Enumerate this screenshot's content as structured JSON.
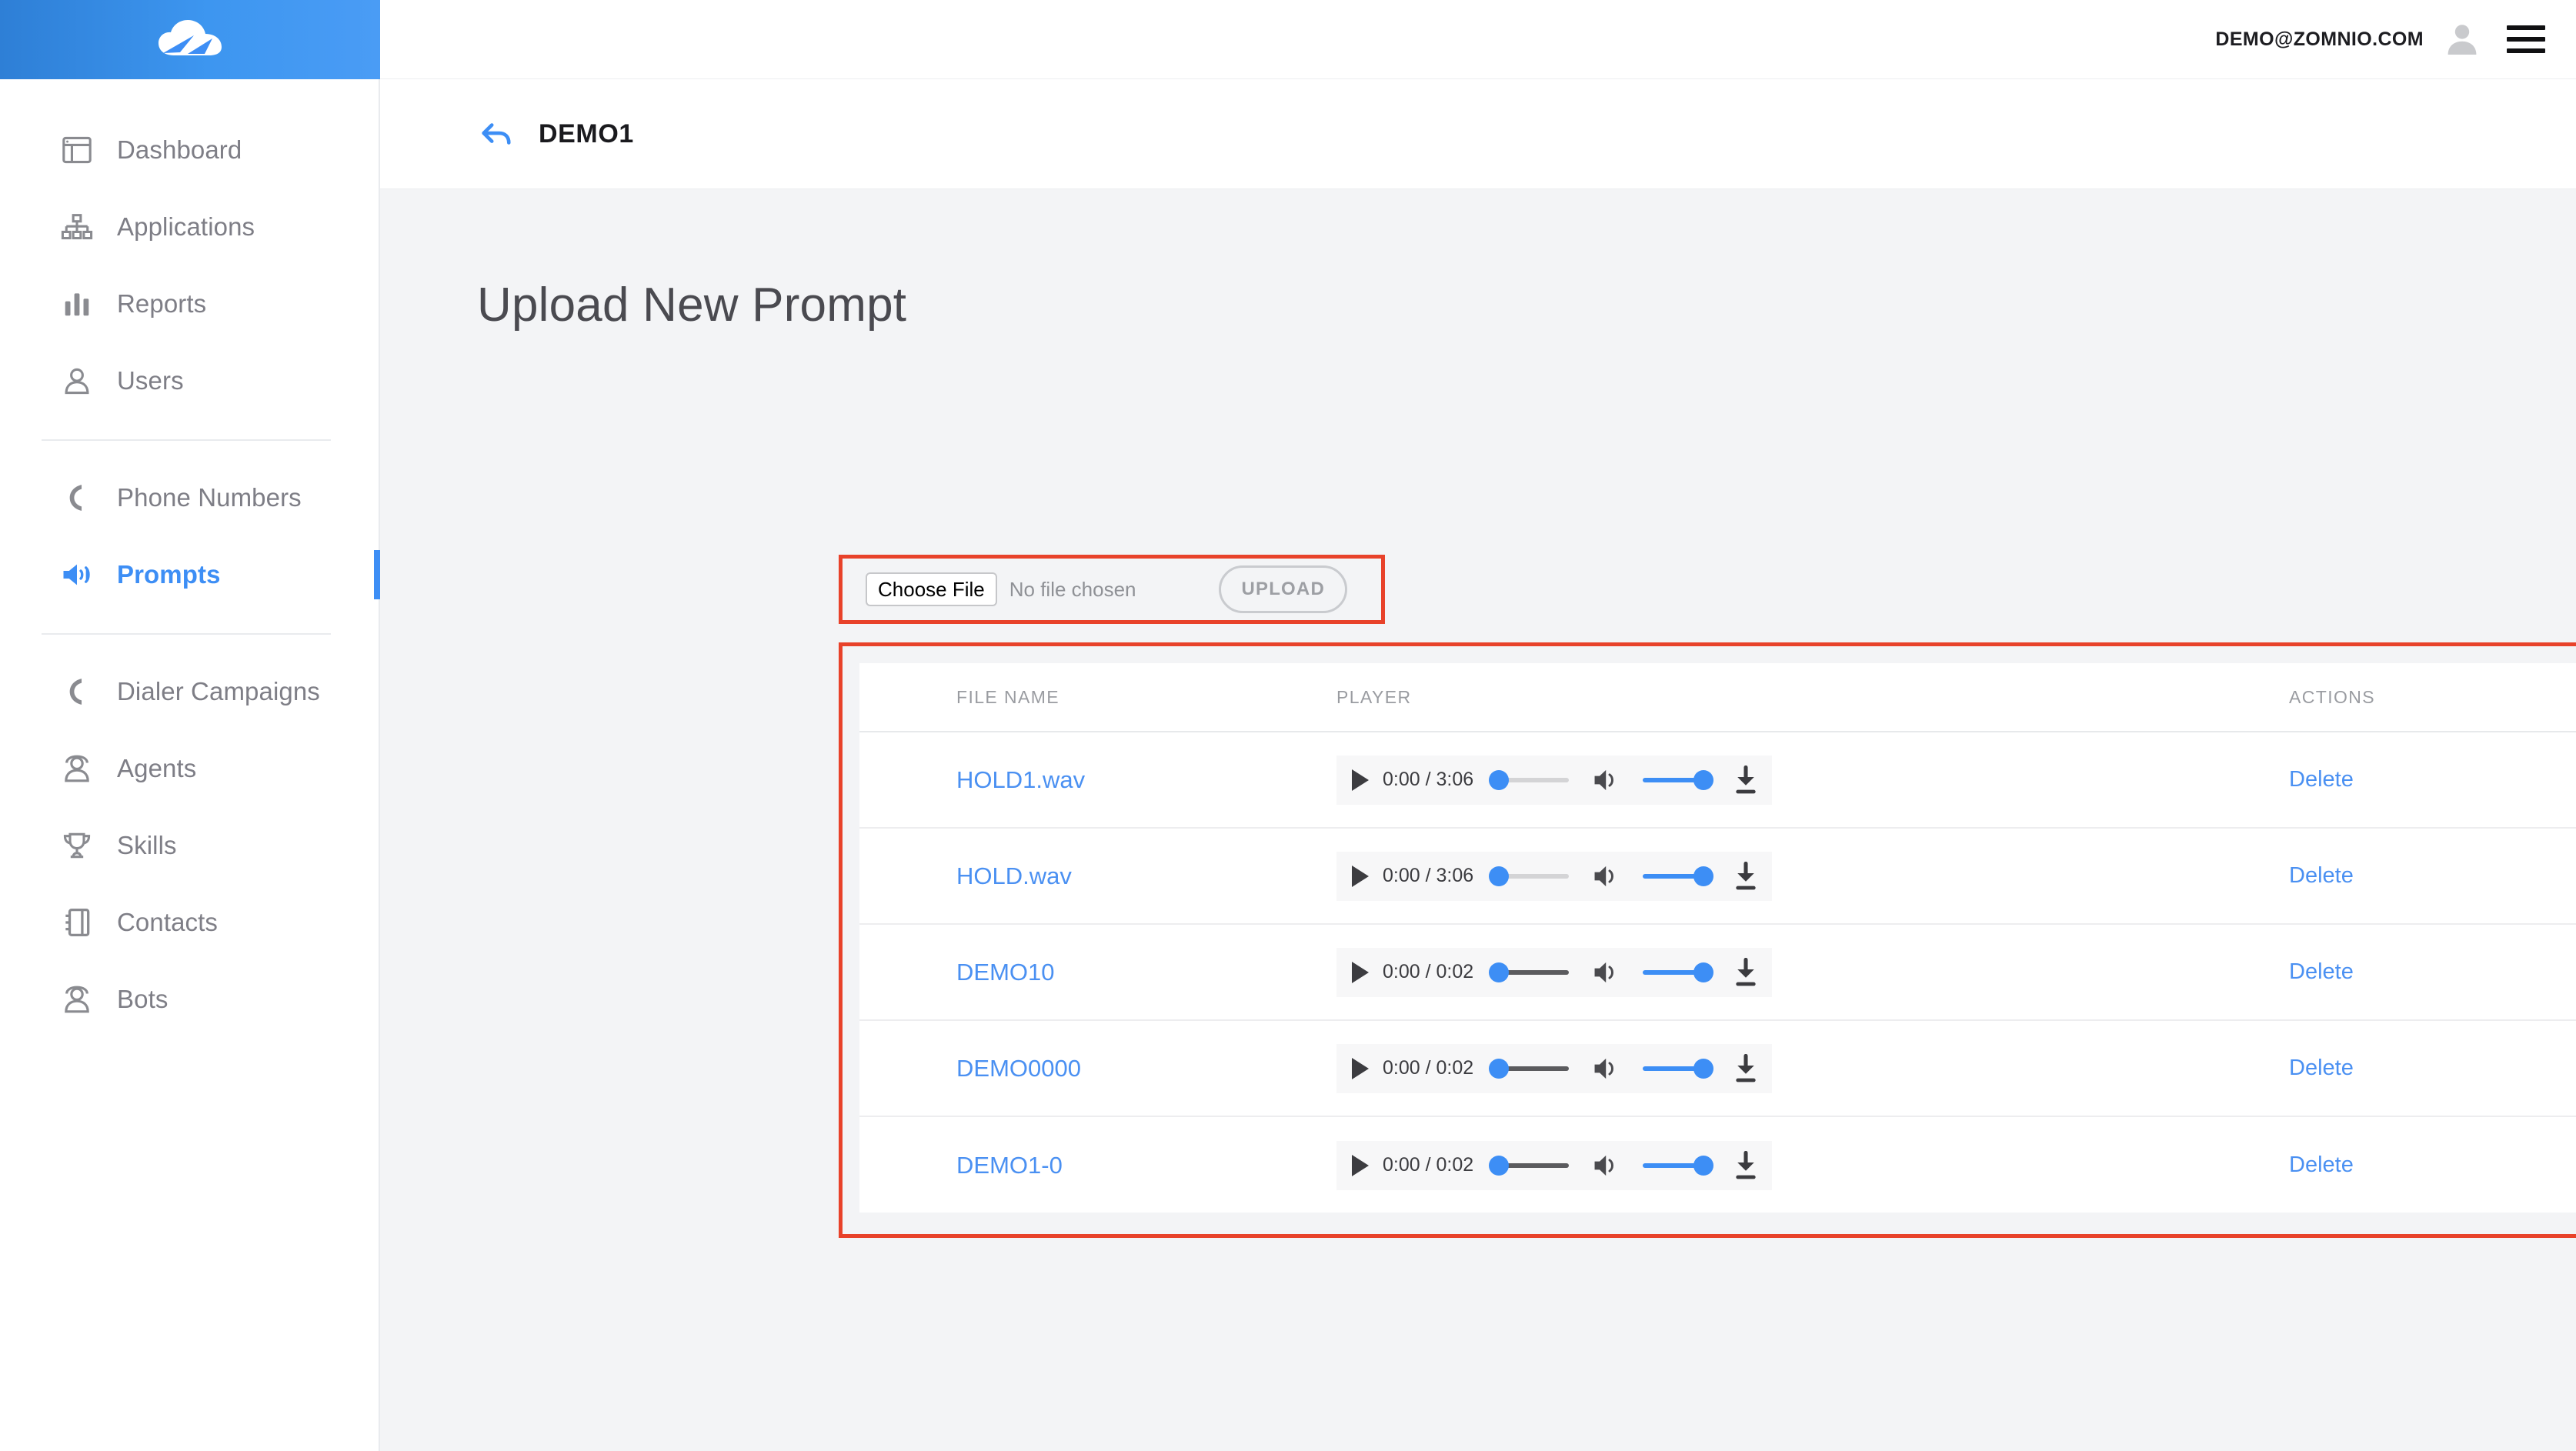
{
  "brand": {
    "logo_name": "cloud-logo",
    "accent_color": "#3d8ef5",
    "highlight_color": "#e8422a",
    "header_gradient_from": "#2e7fd6",
    "header_gradient_to": "#4a9cf5"
  },
  "topbar": {
    "user_email": "DEMO@ZOMNIO.COM",
    "avatar_label": "user-avatar",
    "menu_label": "menu"
  },
  "page_header": {
    "back_label": "back",
    "title": "DEMO1"
  },
  "sidebar": {
    "groups": [
      {
        "items": [
          {
            "label": "Dashboard",
            "icon": "dashboard-icon",
            "active": false
          },
          {
            "label": "Applications",
            "icon": "sitemap-icon",
            "active": false
          },
          {
            "label": "Reports",
            "icon": "bar-chart-icon",
            "active": false
          },
          {
            "label": "Users",
            "icon": "user-icon",
            "active": false
          }
        ]
      },
      {
        "items": [
          {
            "label": "Phone Numbers",
            "icon": "phone-icon",
            "active": false
          },
          {
            "label": "Prompts",
            "icon": "speaker-icon",
            "active": true
          }
        ]
      },
      {
        "items": [
          {
            "label": "Dialer Campaigns",
            "icon": "phone-icon",
            "active": false
          },
          {
            "label": "Agents",
            "icon": "agent-icon",
            "active": false
          },
          {
            "label": "Skills",
            "icon": "trophy-icon",
            "active": false
          },
          {
            "label": "Contacts",
            "icon": "contacts-icon",
            "active": false
          },
          {
            "label": "Bots",
            "icon": "bot-icon",
            "active": false
          }
        ]
      }
    ]
  },
  "main": {
    "section_title": "Upload New Prompt",
    "upload": {
      "choose_file_label": "Choose File",
      "no_file_text": "No file chosen",
      "upload_button_label": "UPLOAD"
    },
    "table": {
      "headers": {
        "file_name": "FILE NAME",
        "player": "PLAYER",
        "actions": "ACTIONS"
      },
      "rows": [
        {
          "file_name": "HOLD1.wav",
          "time": "0:00 / 3:06",
          "seek_progress": 0,
          "seek_buffered": "light",
          "volume": 100,
          "action_label": "Delete"
        },
        {
          "file_name": "HOLD.wav",
          "time": "0:00 / 3:06",
          "seek_progress": 0,
          "seek_buffered": "light",
          "volume": 100,
          "action_label": "Delete"
        },
        {
          "file_name": "DEMO10",
          "time": "0:00 / 0:02",
          "seek_progress": 0,
          "seek_buffered": "dark",
          "volume": 100,
          "action_label": "Delete"
        },
        {
          "file_name": "DEMO0000",
          "time": "0:00 / 0:02",
          "seek_progress": 0,
          "seek_buffered": "dark",
          "volume": 100,
          "action_label": "Delete"
        },
        {
          "file_name": "DEMO1-0",
          "time": "0:00 / 0:02",
          "seek_progress": 0,
          "seek_buffered": "dark",
          "volume": 100,
          "action_label": "Delete"
        }
      ]
    }
  }
}
